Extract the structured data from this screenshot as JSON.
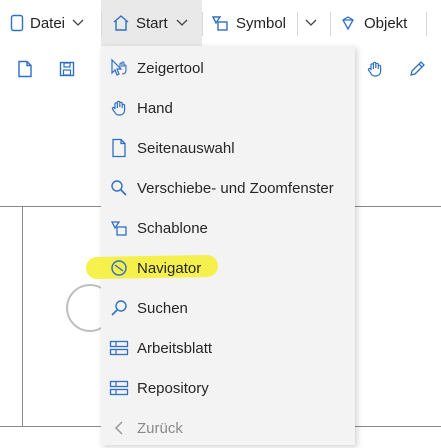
{
  "toolbar": {
    "file_label": "Datei",
    "start_label": "Start",
    "symbol_label": "Symbol",
    "object_label": "Objekt"
  },
  "start_menu": {
    "items": [
      {
        "label": "Zeigertool",
        "icon": "pointer-tool-icon"
      },
      {
        "label": "Hand",
        "icon": "hand-icon"
      },
      {
        "label": "Seitenauswahl",
        "icon": "page-icon"
      },
      {
        "label": "Verschiebe- und Zoomfenster",
        "icon": "zoom-icon"
      },
      {
        "label": "Schablone",
        "icon": "stencil-icon"
      },
      {
        "label": "Navigator",
        "icon": "navigator-icon"
      },
      {
        "label": "Suchen",
        "icon": "search-icon"
      },
      {
        "label": "Arbeitsblatt",
        "icon": "worksheet-icon"
      },
      {
        "label": "Repository",
        "icon": "repository-icon"
      },
      {
        "label": "Zurück",
        "icon": "back-chevron-icon"
      }
    ]
  },
  "colors": {
    "accent": "#2f6fc4",
    "menu_bg": "#f3f3f3",
    "highlight": "#f5ef3a"
  }
}
